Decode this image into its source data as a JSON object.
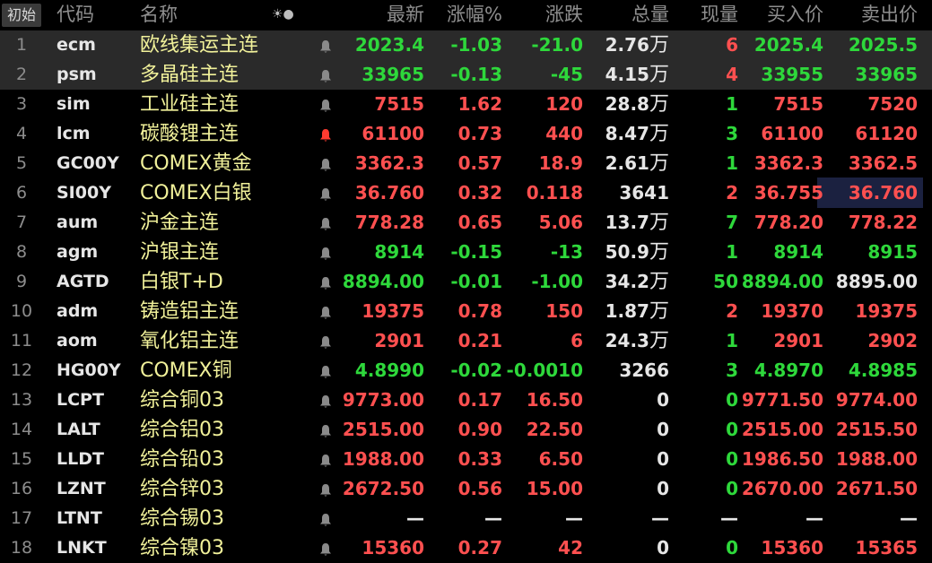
{
  "header": {
    "reset_label": "初始",
    "code": "代码",
    "name": "名称",
    "split_icon": "☀●",
    "last": "最新",
    "pct": "涨幅%",
    "chg": "涨跌",
    "vol": "总量",
    "cur": "现量",
    "bid": "买入价",
    "ask": "卖出价"
  },
  "colors": {
    "up": "#ff5050",
    "down": "#2ed83b",
    "flat": "#e6e6e6",
    "name": "#f1f19a"
  },
  "rows": [
    {
      "idx": "1",
      "code": "ecm",
      "name": "欧线集运主连",
      "alert": false,
      "last": "2023.4",
      "pct": "-1.03",
      "chg": "-21.0",
      "vol": "2.76",
      "vol_unit": "万",
      "cur": "6",
      "bid": "2025.4",
      "ask": "2025.5",
      "c_last": "dn",
      "c_pct": "dn",
      "c_chg": "dn",
      "c_cur": "up",
      "c_bid": "dn",
      "c_ask": "dn",
      "selected": true
    },
    {
      "idx": "2",
      "code": "psm",
      "name": "多晶硅主连",
      "alert": false,
      "last": "33965",
      "pct": "-0.13",
      "chg": "-45",
      "vol": "4.15",
      "vol_unit": "万",
      "cur": "4",
      "bid": "33955",
      "ask": "33965",
      "c_last": "dn",
      "c_pct": "dn",
      "c_chg": "dn",
      "c_cur": "up",
      "c_bid": "dn",
      "c_ask": "dn",
      "selected": true
    },
    {
      "idx": "3",
      "code": "sim",
      "name": "工业硅主连",
      "alert": false,
      "last": "7515",
      "pct": "1.62",
      "chg": "120",
      "vol": "28.8",
      "vol_unit": "万",
      "cur": "1",
      "bid": "7515",
      "ask": "7520",
      "c_last": "up",
      "c_pct": "up",
      "c_chg": "up",
      "c_cur": "dn",
      "c_bid": "up",
      "c_ask": "up"
    },
    {
      "idx": "4",
      "code": "lcm",
      "name": "碳酸锂主连",
      "alert": true,
      "last": "61100",
      "pct": "0.73",
      "chg": "440",
      "vol": "8.47",
      "vol_unit": "万",
      "cur": "3",
      "bid": "61100",
      "ask": "61120",
      "c_last": "up",
      "c_pct": "up",
      "c_chg": "up",
      "c_cur": "dn",
      "c_bid": "up",
      "c_ask": "up"
    },
    {
      "idx": "5",
      "code": "GC00Y",
      "name": "COMEX黄金",
      "alert": false,
      "last": "3362.3",
      "pct": "0.57",
      "chg": "18.9",
      "vol": "2.61",
      "vol_unit": "万",
      "cur": "1",
      "bid": "3362.3",
      "ask": "3362.5",
      "c_last": "up",
      "c_pct": "up",
      "c_chg": "up",
      "c_cur": "dn",
      "c_bid": "up",
      "c_ask": "up"
    },
    {
      "idx": "6",
      "code": "SI00Y",
      "name": "COMEX白银",
      "alert": false,
      "last": "36.760",
      "pct": "0.32",
      "chg": "0.118",
      "vol": "3641",
      "vol_unit": "",
      "cur": "2",
      "bid": "36.755",
      "ask": "36.760",
      "c_last": "up",
      "c_pct": "up",
      "c_chg": "up",
      "c_cur": "up",
      "c_bid": "up",
      "c_ask": "up",
      "ask_highlight": true
    },
    {
      "idx": "7",
      "code": "aum",
      "name": "沪金主连",
      "alert": false,
      "last": "778.28",
      "pct": "0.65",
      "chg": "5.06",
      "vol": "13.7",
      "vol_unit": "万",
      "cur": "7",
      "bid": "778.20",
      "ask": "778.22",
      "c_last": "up",
      "c_pct": "up",
      "c_chg": "up",
      "c_cur": "dn",
      "c_bid": "up",
      "c_ask": "up"
    },
    {
      "idx": "8",
      "code": "agm",
      "name": "沪银主连",
      "alert": false,
      "last": "8914",
      "pct": "-0.15",
      "chg": "-13",
      "vol": "50.9",
      "vol_unit": "万",
      "cur": "1",
      "bid": "8914",
      "ask": "8915",
      "c_last": "dn",
      "c_pct": "dn",
      "c_chg": "dn",
      "c_cur": "dn",
      "c_bid": "dn",
      "c_ask": "dn"
    },
    {
      "idx": "9",
      "code": "AGTD",
      "name": "白银T+D",
      "alert": false,
      "last": "8894.00",
      "pct": "-0.01",
      "chg": "-1.00",
      "vol": "34.2",
      "vol_unit": "万",
      "cur": "50",
      "bid": "8894.00",
      "ask": "8895.00",
      "c_last": "dn",
      "c_pct": "dn",
      "c_chg": "dn",
      "c_cur": "dn",
      "c_bid": "dn",
      "c_ask": "fl"
    },
    {
      "idx": "10",
      "code": "adm",
      "name": "铸造铝主连",
      "alert": false,
      "last": "19375",
      "pct": "0.78",
      "chg": "150",
      "vol": "1.87",
      "vol_unit": "万",
      "cur": "2",
      "bid": "19370",
      "ask": "19375",
      "c_last": "up",
      "c_pct": "up",
      "c_chg": "up",
      "c_cur": "up",
      "c_bid": "up",
      "c_ask": "up"
    },
    {
      "idx": "11",
      "code": "aom",
      "name": "氧化铝主连",
      "alert": false,
      "last": "2901",
      "pct": "0.21",
      "chg": "6",
      "vol": "24.3",
      "vol_unit": "万",
      "cur": "1",
      "bid": "2901",
      "ask": "2902",
      "c_last": "up",
      "c_pct": "up",
      "c_chg": "up",
      "c_cur": "dn",
      "c_bid": "up",
      "c_ask": "up"
    },
    {
      "idx": "12",
      "code": "HG00Y",
      "name": "COMEX铜",
      "alert": false,
      "last": "4.8990",
      "pct": "-0.02",
      "chg": "-0.0010",
      "vol": "3266",
      "vol_unit": "",
      "cur": "3",
      "bid": "4.8970",
      "ask": "4.8985",
      "c_last": "dn",
      "c_pct": "dn",
      "c_chg": "dn",
      "c_cur": "dn",
      "c_bid": "dn",
      "c_ask": "dn"
    },
    {
      "idx": "13",
      "code": "LCPT",
      "name": "综合铜03",
      "alert": false,
      "last": "9773.00",
      "pct": "0.17",
      "chg": "16.50",
      "vol": "0",
      "vol_unit": "",
      "cur": "0",
      "bid": "9771.50",
      "ask": "9774.00",
      "c_last": "up",
      "c_pct": "up",
      "c_chg": "up",
      "c_cur": "dn",
      "c_bid": "up",
      "c_ask": "up"
    },
    {
      "idx": "14",
      "code": "LALT",
      "name": "综合铝03",
      "alert": false,
      "last": "2515.00",
      "pct": "0.90",
      "chg": "22.50",
      "vol": "0",
      "vol_unit": "",
      "cur": "0",
      "bid": "2515.00",
      "ask": "2515.50",
      "c_last": "up",
      "c_pct": "up",
      "c_chg": "up",
      "c_cur": "dn",
      "c_bid": "up",
      "c_ask": "up"
    },
    {
      "idx": "15",
      "code": "LLDT",
      "name": "综合铅03",
      "alert": false,
      "last": "1988.00",
      "pct": "0.33",
      "chg": "6.50",
      "vol": "0",
      "vol_unit": "",
      "cur": "0",
      "bid": "1986.50",
      "ask": "1988.00",
      "c_last": "up",
      "c_pct": "up",
      "c_chg": "up",
      "c_cur": "dn",
      "c_bid": "up",
      "c_ask": "up"
    },
    {
      "idx": "16",
      "code": "LZNT",
      "name": "综合锌03",
      "alert": false,
      "last": "2672.50",
      "pct": "0.56",
      "chg": "15.00",
      "vol": "0",
      "vol_unit": "",
      "cur": "0",
      "bid": "2670.00",
      "ask": "2671.50",
      "c_last": "up",
      "c_pct": "up",
      "c_chg": "up",
      "c_cur": "dn",
      "c_bid": "up",
      "c_ask": "up"
    },
    {
      "idx": "17",
      "code": "LTNT",
      "name": "综合锡03",
      "alert": false,
      "last": "—",
      "pct": "—",
      "chg": "—",
      "vol": "—",
      "vol_unit": "",
      "cur": "—",
      "bid": "—",
      "ask": "—",
      "c_last": "fl",
      "c_pct": "fl",
      "c_chg": "fl",
      "c_cur": "fl",
      "c_bid": "fl",
      "c_ask": "fl"
    },
    {
      "idx": "18",
      "code": "LNKT",
      "name": "综合镍03",
      "alert": false,
      "last": "15360",
      "pct": "0.27",
      "chg": "42",
      "vol": "0",
      "vol_unit": "",
      "cur": "0",
      "bid": "15360",
      "ask": "15365",
      "c_last": "up",
      "c_pct": "up",
      "c_chg": "up",
      "c_cur": "dn",
      "c_bid": "up",
      "c_ask": "up"
    }
  ]
}
